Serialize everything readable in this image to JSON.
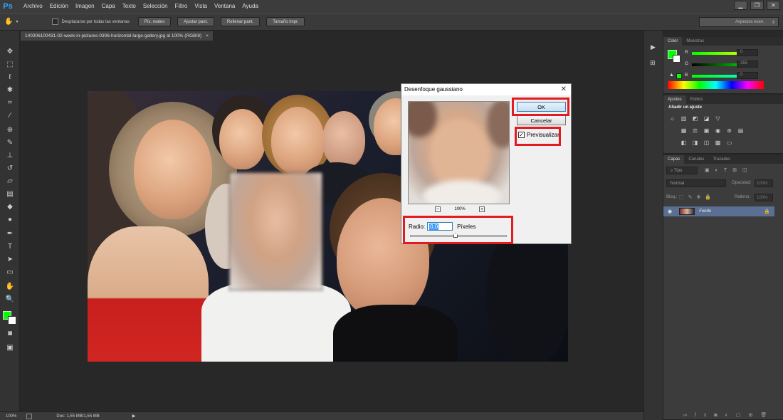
{
  "app": {
    "logo": "Ps"
  },
  "menu": [
    "Archivo",
    "Edición",
    "Imagen",
    "Capa",
    "Texto",
    "Selección",
    "Filtro",
    "Vista",
    "Ventana",
    "Ayuda"
  ],
  "window_controls": {
    "minimize": "▁",
    "restore": "❐",
    "close": "✕"
  },
  "options": {
    "scroll_all_label": "Desplazarse por todas las ventanas",
    "buttons": [
      "Píx. reales",
      "Ajustar pant.",
      "Rellenar pant.",
      "Tamaño impr."
    ],
    "workspace": "Aspectos esen."
  },
  "document": {
    "tab_title": "140306100431-02-week-in-pictures-0306-horizontal-large-gallery.jpg al 100% (RGB/8)",
    "tab_close": "×"
  },
  "status": {
    "zoom": "100%",
    "doc": "Doc: 1,55 MB/1,55 MB"
  },
  "color_panel": {
    "tabs": [
      "Color",
      "Muestras"
    ],
    "fg_color": "#00ff00",
    "channels": [
      {
        "label": "R",
        "value": "0"
      },
      {
        "label": "G",
        "value": "255"
      },
      {
        "label": "B",
        "value": "0"
      }
    ]
  },
  "adjustments_panel": {
    "tabs": [
      "Ajustes",
      "Estilos"
    ],
    "title": "Añadir un ajuste"
  },
  "layers_panel": {
    "tabs": [
      "Capas",
      "Canales",
      "Trazados"
    ],
    "filter": "Tipo",
    "blend_mode": "Normal",
    "opacity_label": "Opacidad:",
    "opacity_value": "100%",
    "lock_label": "Bloq.:",
    "fill_label": "Relleno:",
    "fill_value": "100%",
    "layer_name": "Fondo"
  },
  "dialog": {
    "title": "Desenfoque gaussiano",
    "ok_label": "OK",
    "cancel_label": "Cancelar",
    "preview_label": "Previsualizar",
    "preview_checked": true,
    "zoom_value": "100%",
    "radius_label": "Radio:",
    "radius_value": "0,0",
    "radius_unit": "Píxeles",
    "highlight_color": "#e11b22"
  }
}
